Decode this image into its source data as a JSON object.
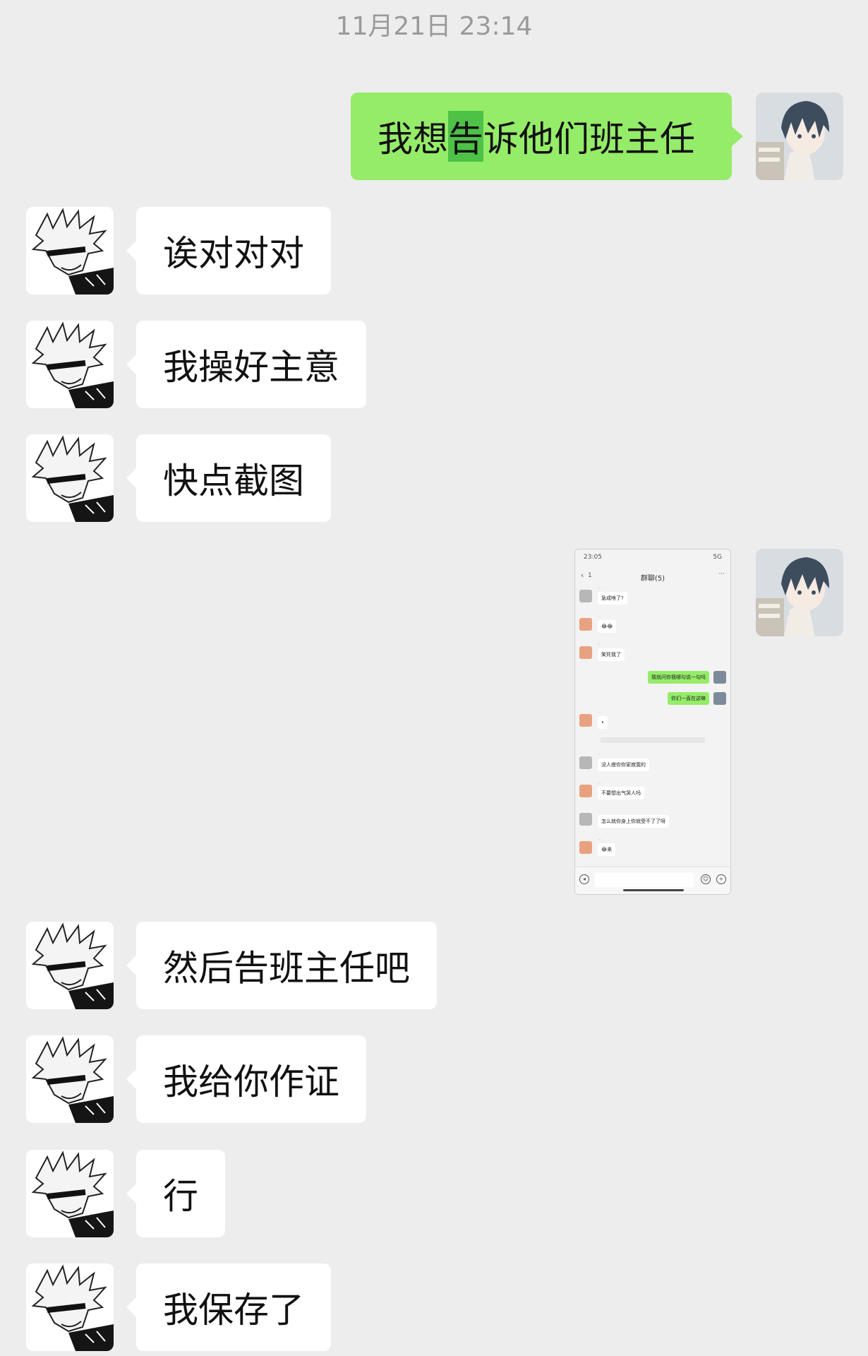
{
  "timestamp": "11月21日 23:14",
  "messages": [
    {
      "side": "right",
      "pre": "我想",
      "hl": "告",
      "post": "诉他们班主任"
    },
    {
      "side": "left",
      "text": "诶对对对"
    },
    {
      "side": "left",
      "text": "我操好主意"
    },
    {
      "side": "left",
      "text": "快点截图"
    },
    {
      "side": "left",
      "text": "然后告班主任吧"
    },
    {
      "side": "left",
      "text": "我给你作证"
    },
    {
      "side": "left",
      "text": "行"
    },
    {
      "side": "left",
      "text": "我保存了"
    }
  ],
  "screenshot": {
    "status_time": "23:05",
    "status_right": "5G",
    "back_badge": "1",
    "title": "群聊(5)",
    "more": "···",
    "items": [
      {
        "side": "left",
        "text": "急成啥了?"
      },
      {
        "side": "left",
        "text": "😂😂"
      },
      {
        "side": "left",
        "text": "笑死我了"
      },
      {
        "side": "right",
        "text": "我就问你我哪句说一句吗"
      },
      {
        "side": "right",
        "text": "你们一直在这嘛"
      },
      {
        "side": "left",
        "text": "•"
      },
      {
        "side": "left",
        "text": "没人搭你你家寂寞的"
      },
      {
        "side": "left",
        "text": "不要想出气哭人吗"
      },
      {
        "side": "left",
        "text": "怎么就你身上你就受不了了呀"
      },
      {
        "side": "left",
        "text": "😂来"
      }
    ]
  },
  "icons": {
    "user_avatar": "avatar-anime-boy-icon",
    "friend_avatar": "avatar-manga-white-hair-icon"
  },
  "colors": {
    "background": "#ededed",
    "bubble_left": "#ffffff",
    "bubble_right": "#95ec69",
    "highlight": "#4dc247"
  }
}
